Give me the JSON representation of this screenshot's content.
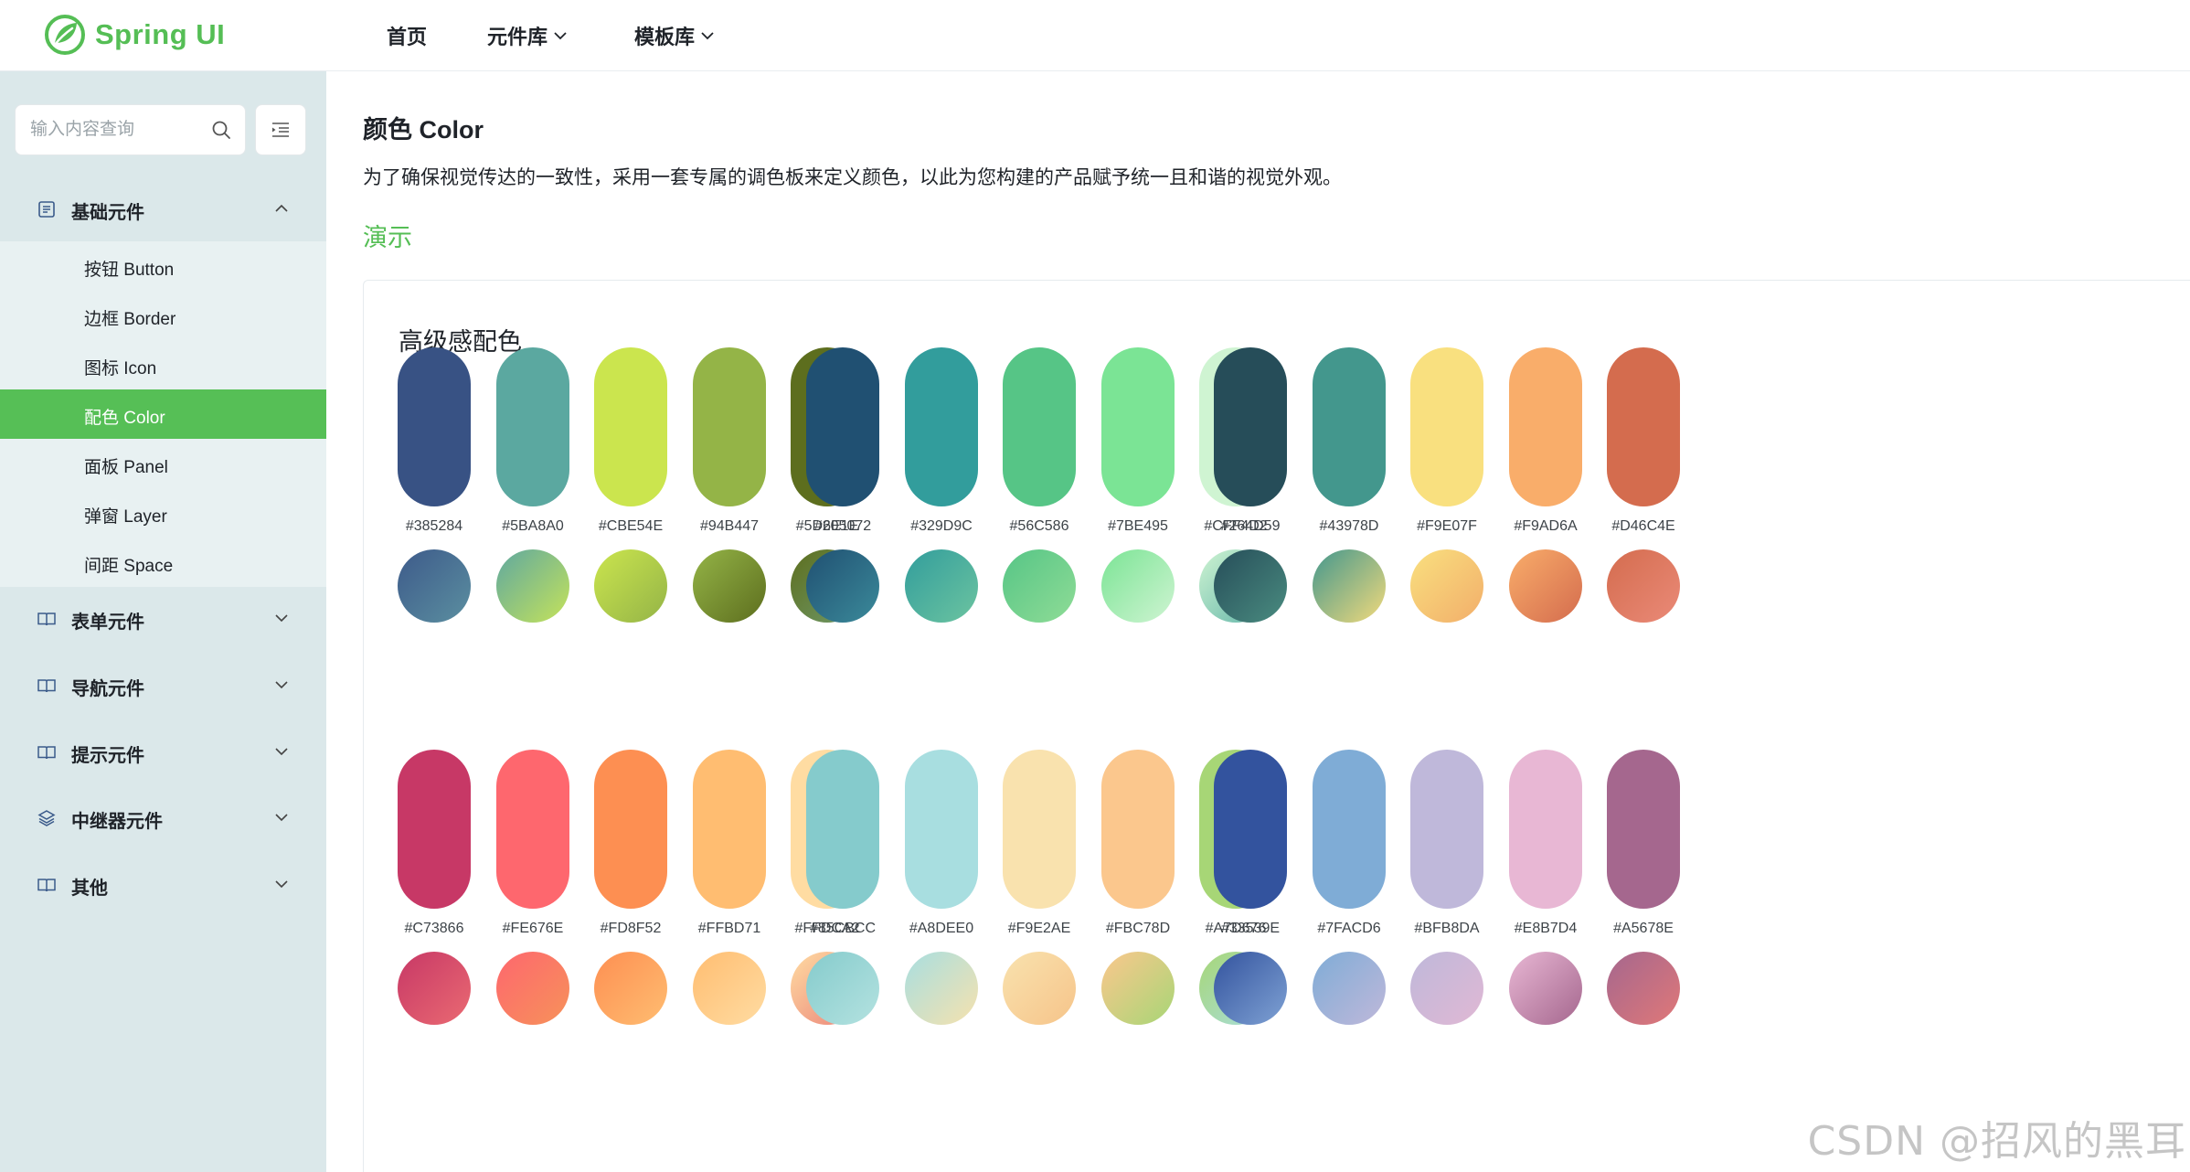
{
  "app": {
    "logo_text": "Spring UI"
  },
  "nav": [
    {
      "label": "首页",
      "has_dropdown": false
    },
    {
      "label": "元件库",
      "has_dropdown": true
    },
    {
      "label": "模板库",
      "has_dropdown": true
    }
  ],
  "sidebar": {
    "search_placeholder": "输入内容查询",
    "groups": [
      {
        "label": "基础元件",
        "icon": "document-icon",
        "expanded": true
      },
      {
        "label": "表单元件",
        "icon": "book-icon",
        "expanded": false
      },
      {
        "label": "导航元件",
        "icon": "book-icon",
        "expanded": false
      },
      {
        "label": "提示元件",
        "icon": "book-icon",
        "expanded": false
      },
      {
        "label": "中继器元件",
        "icon": "layers-icon",
        "expanded": false
      },
      {
        "label": "其他",
        "icon": "book-icon",
        "expanded": false
      }
    ],
    "sub_items": [
      {
        "label": "按钮 Button",
        "active": false
      },
      {
        "label": "边框 Border",
        "active": false
      },
      {
        "label": "图标 Icon",
        "active": false
      },
      {
        "label": "配色 Color",
        "active": true
      },
      {
        "label": "面板 Panel",
        "active": false
      },
      {
        "label": "弹窗 Layer",
        "active": false
      },
      {
        "label": "间距 Space",
        "active": false
      }
    ]
  },
  "main": {
    "title": "颜色 Color",
    "description": "为了确保视觉传达的一致性，采用一套专属的调色板来定义颜色，以此为您构建的产品赋予统一且和谐的视觉外观。",
    "demo_label": "演示",
    "card_title": "高级感配色",
    "palettes": [
      {
        "colors": [
          "#385284",
          "#5BA8A0",
          "#CBE54E",
          "#94B447",
          "#5D6E1E"
        ],
        "gradients": [
          [
            "#3d5a8a",
            "#5b8fa0"
          ],
          [
            "#5fa8a0",
            "#c5e35a"
          ],
          [
            "#cbe54e",
            "#94b447"
          ],
          [
            "#94b447",
            "#5d6e1e"
          ],
          [
            "#5d6e1e",
            "#6f9a6a"
          ]
        ]
      },
      {
        "colors": [
          "#205072",
          "#329D9C",
          "#56C586",
          "#7BE495",
          "#CFF4D2"
        ],
        "gradients": [
          [
            "#205072",
            "#3b8a9a"
          ],
          [
            "#329d9c",
            "#6cc4a0"
          ],
          [
            "#56c586",
            "#8fdc96"
          ],
          [
            "#7be495",
            "#cff4d2"
          ],
          [
            "#cff4d2",
            "#5fb3a8"
          ]
        ]
      },
      {
        "colors": [
          "#264D59",
          "#43978D",
          "#F9E07F",
          "#F9AD6A",
          "#D46C4E"
        ],
        "gradients": [
          [
            "#264d59",
            "#4a8c80"
          ],
          [
            "#43978d",
            "#f2da7c"
          ],
          [
            "#f9e07f",
            "#f2ae6a"
          ],
          [
            "#f9ad6a",
            "#d46c4e"
          ],
          [
            "#d46c4e",
            "#ea8a78"
          ]
        ]
      },
      {
        "colors": [
          "#C73866",
          "#FE676E",
          "#FD8F52",
          "#FFBD71",
          "#FFDCA2"
        ],
        "gradients": [
          [
            "#c73866",
            "#ea6a72"
          ],
          [
            "#fe676e",
            "#f6925a"
          ],
          [
            "#fd8f52",
            "#ffbd71"
          ],
          [
            "#ffbd71",
            "#ffdca2"
          ],
          [
            "#ffdca2",
            "#ea8078"
          ]
        ]
      },
      {
        "colors": [
          "#85CBCC",
          "#A8DEE0",
          "#F9E2AE",
          "#FBC78D",
          "#A7D676"
        ],
        "gradients": [
          [
            "#85cbcc",
            "#b4e2e0"
          ],
          [
            "#a8dee0",
            "#f6e2ae"
          ],
          [
            "#f9e2ae",
            "#f6c48a"
          ],
          [
            "#fbc78d",
            "#a7d676"
          ],
          [
            "#a7d676",
            "#a8dee0"
          ]
        ]
      },
      {
        "colors": [
          "#33539E",
          "#7FACD6",
          "#BFB8DA",
          "#E8B7D4",
          "#A5678E"
        ],
        "gradients": [
          [
            "#33539e",
            "#7fa2d4"
          ],
          [
            "#7facd6",
            "#bfb8da"
          ],
          [
            "#bfb8da",
            "#e0b8d4"
          ],
          [
            "#e8b7d4",
            "#a5678e"
          ],
          [
            "#a5678e",
            "#e07878"
          ]
        ]
      }
    ]
  },
  "watermark": "CSDN @招风的黑耳"
}
